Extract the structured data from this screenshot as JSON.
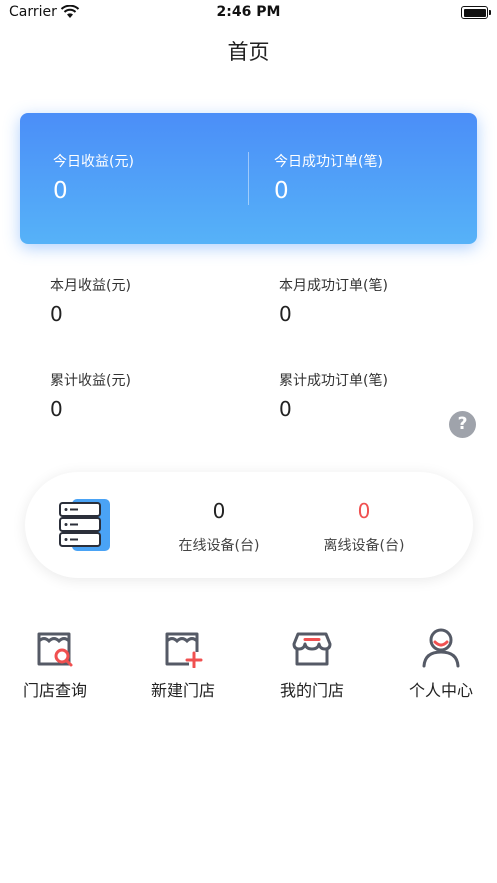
{
  "status_bar": {
    "carrier": "Carrier",
    "time": "2:46 PM"
  },
  "nav": {
    "title": "首页"
  },
  "today": {
    "revenue_label": "今日收益(元)",
    "revenue_value": "0",
    "orders_label": "今日成功订单(笔)",
    "orders_value": "0"
  },
  "month": {
    "revenue_label": "本月收益(元)",
    "revenue_value": "0",
    "orders_label": "本月成功订单(笔)",
    "orders_value": "0"
  },
  "total": {
    "revenue_label": "累计收益(元)",
    "revenue_value": "0",
    "orders_label": "累计成功订单(笔)",
    "orders_value": "0"
  },
  "help": {
    "symbol": "?"
  },
  "devices": {
    "online_value": "0",
    "online_label": "在线设备(台)",
    "offline_value": "0",
    "offline_label": "离线设备(台)"
  },
  "menu": [
    {
      "label": "门店查询",
      "icon": "store-search-icon"
    },
    {
      "label": "新建门店",
      "icon": "store-add-icon"
    },
    {
      "label": "我的门店",
      "icon": "my-store-icon"
    },
    {
      "label": "个人中心",
      "icon": "user-icon"
    }
  ],
  "colors": {
    "accent": "#4b8ef8",
    "offline": "#f05050",
    "icon_gray": "#555a66",
    "icon_red": "#f05050"
  }
}
